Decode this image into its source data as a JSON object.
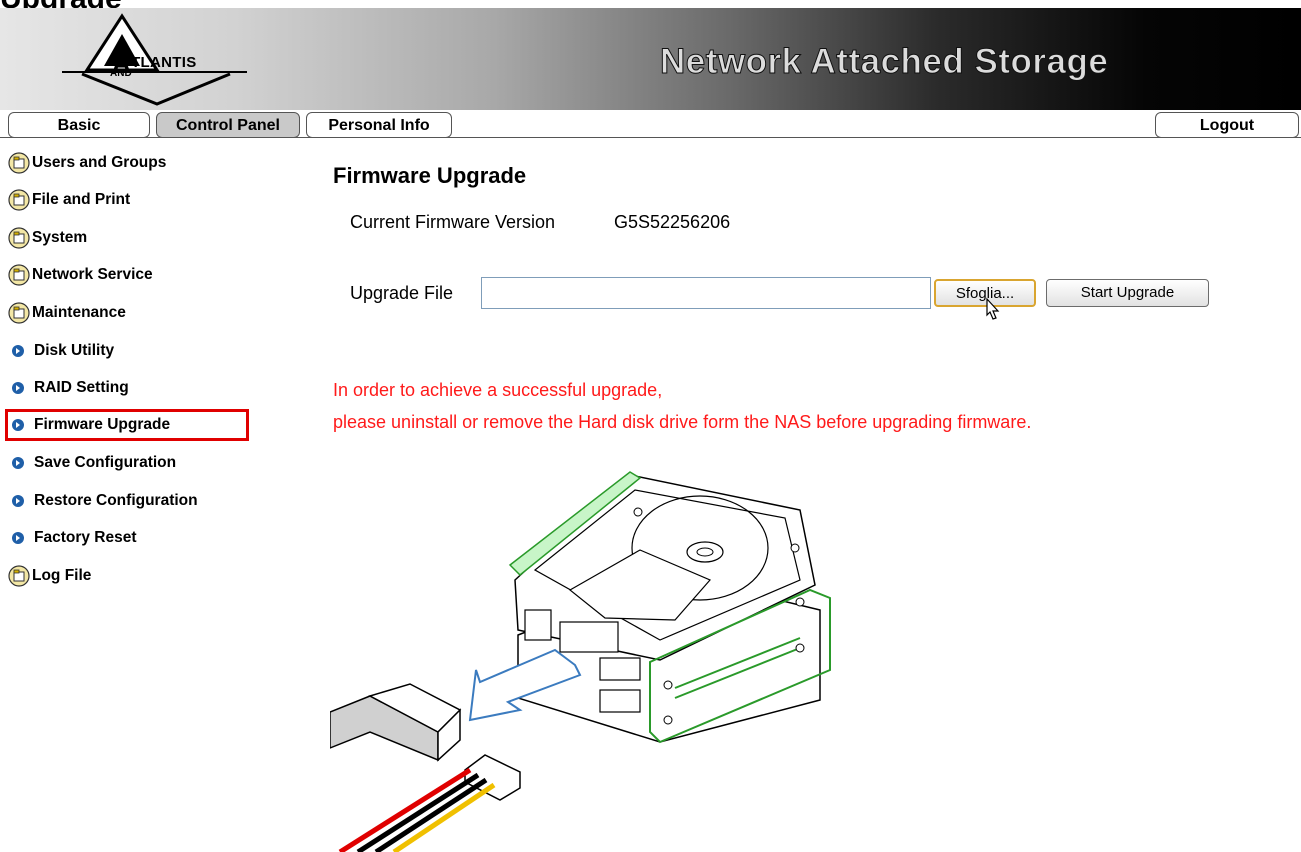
{
  "page_heading_partial": "Upgrade",
  "header": {
    "logo_text": "TLANTIS",
    "logo_letter": "A",
    "logo_sub": "AND",
    "title": "Network Attached Storage"
  },
  "tabs": [
    {
      "label": "Basic",
      "active": false
    },
    {
      "label": "Control Panel",
      "active": true
    },
    {
      "label": "Personal Info",
      "active": false
    }
  ],
  "logout_label": "Logout",
  "sidebar": {
    "items": [
      {
        "label": "Users and Groups",
        "icon": "folder-icon"
      },
      {
        "label": "File and Print",
        "icon": "folder-icon"
      },
      {
        "label": "System",
        "icon": "folder-icon"
      },
      {
        "label": "Network Service",
        "icon": "folder-icon"
      },
      {
        "label": "Maintenance",
        "icon": "folder-icon"
      },
      {
        "label": "Disk Utility",
        "icon": "arrow-icon"
      },
      {
        "label": "RAID Setting",
        "icon": "arrow-icon"
      },
      {
        "label": "Firmware Upgrade",
        "icon": "arrow-icon",
        "selected": true
      },
      {
        "label": "Save Configuration",
        "icon": "arrow-icon"
      },
      {
        "label": "Restore Configuration",
        "icon": "arrow-icon"
      },
      {
        "label": "Factory Reset",
        "icon": "arrow-icon"
      },
      {
        "label": "Log File",
        "icon": "folder-icon"
      }
    ]
  },
  "main": {
    "title": "Firmware Upgrade",
    "firmware_label": "Current Firmware Version",
    "firmware_value": "G5S52256206",
    "upgrade_file_label": "Upgrade File",
    "upgrade_file_value": "",
    "browse_label": "Sfoglia...",
    "start_label": "Start Upgrade",
    "warning_line1": "In order to achieve a successful upgrade,",
    "warning_line2": "please uninstall or remove the Hard disk drive form the NAS before upgrading firmware."
  },
  "colors": {
    "warning": "#ff1a1a",
    "highlight_border": "#e00000",
    "arrow_icon": "#1f5fa8",
    "active_tab": "#c9c9c9"
  }
}
